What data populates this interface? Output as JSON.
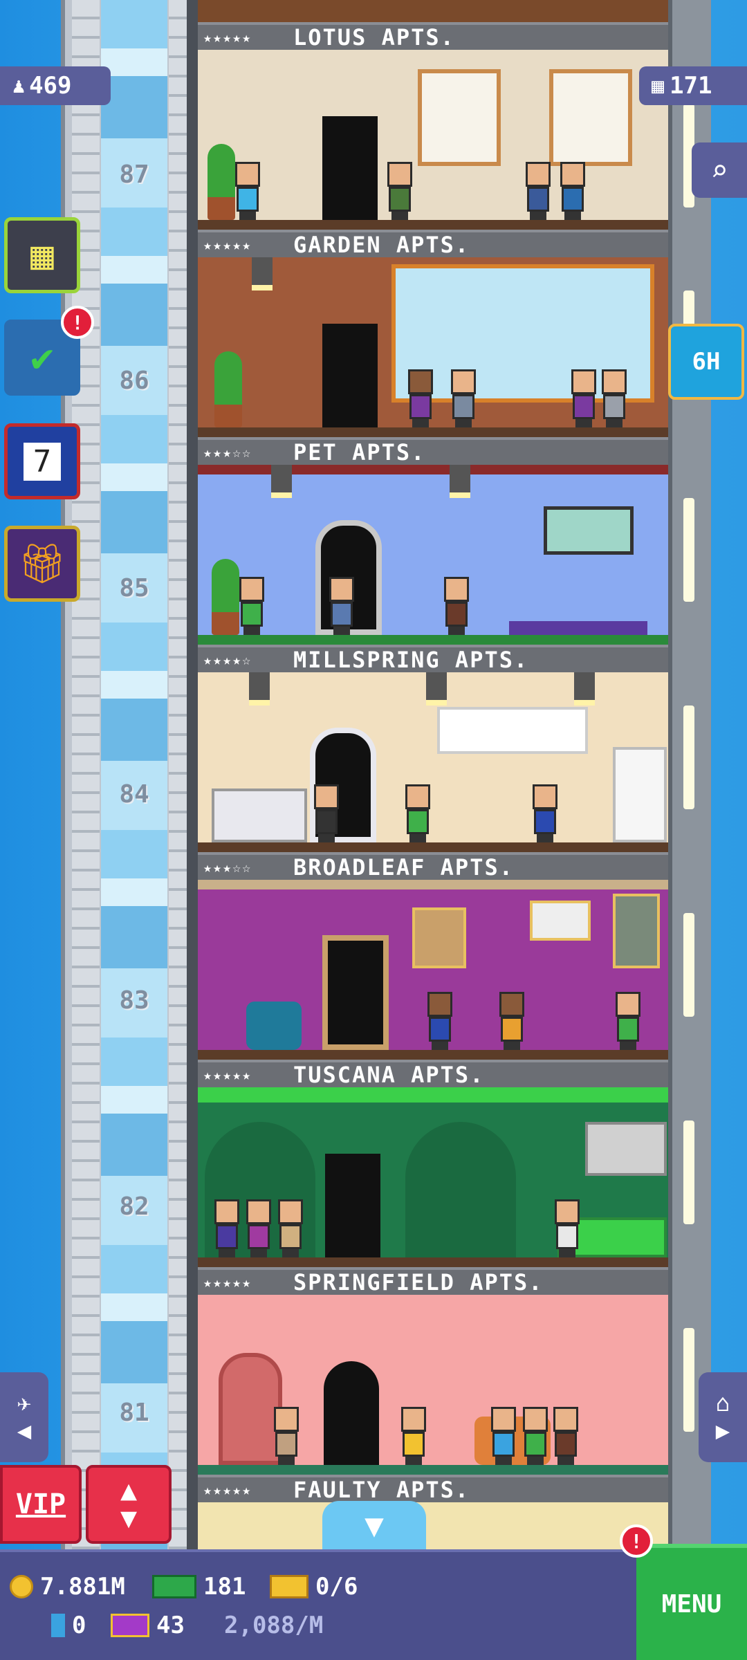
{
  "header": {
    "population": "469",
    "floors_count": "171"
  },
  "floors": [
    {
      "name": "LOTUS APTS.",
      "stars": "★★★★★",
      "number": "87"
    },
    {
      "name": "GARDEN APTS.",
      "stars": "★★★★★",
      "number": "86"
    },
    {
      "name": "PET APTS.",
      "stars": "★★★☆☆",
      "number": "85"
    },
    {
      "name": "MILLSPRING APTS.",
      "stars": "★★★★☆",
      "number": "84"
    },
    {
      "name": "BROADLEAF APTS.",
      "stars": "★★★☆☆",
      "number": "83"
    },
    {
      "name": "TUSCANA APTS.",
      "stars": "★★★★★",
      "number": "82"
    },
    {
      "name": "SPRINGFIELD APTS.",
      "stars": "★★★★★",
      "number": "81"
    },
    {
      "name": "FAULTY APTS.",
      "stars": "★★★★★",
      "number": ""
    }
  ],
  "side_buttons": {
    "missions_alert": "!",
    "calendar_day": "7",
    "timer_label": "6H",
    "menu_alert": "!"
  },
  "controls": {
    "vip_label": "VIP",
    "elevator_up": "▲",
    "elevator_down": "▼",
    "scroll_down": "▼",
    "nav_left_glyph": "◀",
    "nav_right_glyph": "▶",
    "menu_label": "MENU"
  },
  "stats": {
    "coins": "7.881M",
    "bux": "181",
    "tickets": "0/6",
    "gems": "0",
    "vip_cards": "43",
    "rate": "2,088/M"
  },
  "icons": {
    "population": "person-icon",
    "floors": "building-icon",
    "search": "magnifier-icon",
    "build": "build-floor-icon",
    "missions": "checklist-icon",
    "calendar": "calendar-icon",
    "gift": "gift-icon",
    "nav_left": "airplane-icon",
    "nav_right": "home-icon"
  },
  "colors": {
    "sky": "#2e9be4",
    "ui_panel": "#5a5e9a",
    "vip_red": "#e7304a",
    "menu_green": "#2bb24a",
    "alert_red": "#e21f3a"
  }
}
